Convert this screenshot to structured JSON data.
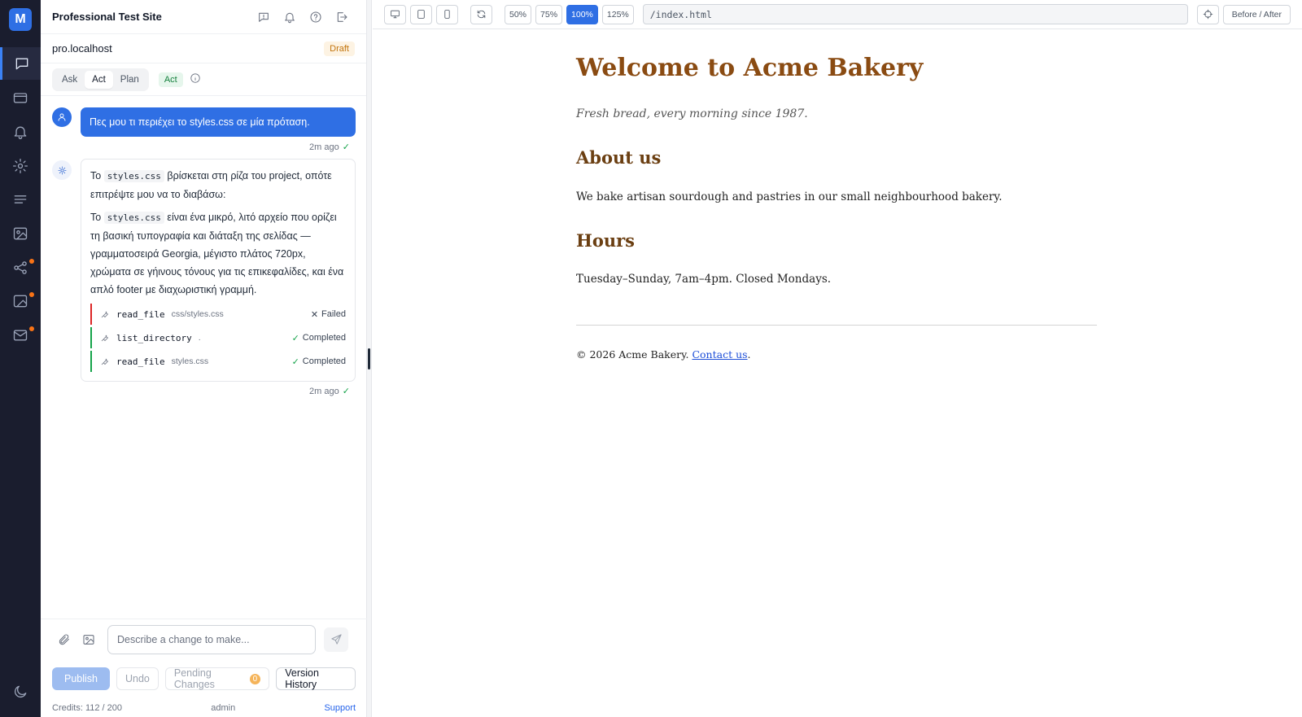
{
  "rail": {
    "logo": "M"
  },
  "panel": {
    "title": "Professional Test Site",
    "host": "pro.localhost",
    "status_badge": "Draft",
    "modes": [
      "Ask",
      "Act",
      "Plan"
    ],
    "active_mode": "Act",
    "mode_pill": "Act"
  },
  "chat": {
    "user_message": "Πες μου τι περιέχει το styles.css σε μία πρόταση.",
    "user_time": "2m ago",
    "bot_p1_a": "Το ",
    "bot_p1_code": "styles.css",
    "bot_p1_b": " βρίσκεται στη ρίζα του project, οπότε επιτρέψτε μου να το διαβάσω:",
    "bot_p2_a": "Το ",
    "bot_p2_code": "styles.css",
    "bot_p2_b": " είναι ένα μικρό, λιτό αρχείο που ορίζει τη βασική τυπογραφία και διάταξη της σελίδας — γραμματοσειρά Georgia, μέγιστο πλάτος 720px, χρώματα σε γήινους τόνους για τις επικεφαλίδες, και ένα απλό footer με διαχωριστική γραμμή.",
    "tools": [
      {
        "name": "read_file",
        "arg": "css/styles.css",
        "status": "Failed"
      },
      {
        "name": "list_directory",
        "arg": ".",
        "status": "Completed"
      },
      {
        "name": "read_file",
        "arg": "styles.css",
        "status": "Completed"
      }
    ],
    "bot_time": "2m ago"
  },
  "composer": {
    "placeholder": "Describe a change to make..."
  },
  "actions": {
    "publish": "Publish",
    "undo": "Undo",
    "pending": "Pending Changes",
    "pending_count": "0",
    "history": "Version History"
  },
  "footer": {
    "credits": "Credits: 112 / 200",
    "user": "admin",
    "support": "Support"
  },
  "toolbar": {
    "zooms": [
      "50%",
      "75%",
      "100%",
      "125%"
    ],
    "active_zoom": "100%",
    "url": "/index.html",
    "before_after": "Before / After"
  },
  "preview": {
    "h1": "Welcome to Acme Bakery",
    "tagline": "Fresh bread, every morning since 1987.",
    "h2_about": "About us",
    "about_text": "We bake artisan sourdough and pastries in our small neighbourhood bakery.",
    "h2_hours": "Hours",
    "hours_text": "Tuesday–Sunday, 7am–4pm. Closed Mondays.",
    "footer_text": "© 2026 Acme Bakery. ",
    "footer_link": "Contact us",
    "footer_end": "."
  },
  "colors": {
    "accent": "#2f6fe4",
    "rail": "#1a1d2e",
    "heading": "#8a4b12",
    "subheading": "#6b3f12"
  }
}
